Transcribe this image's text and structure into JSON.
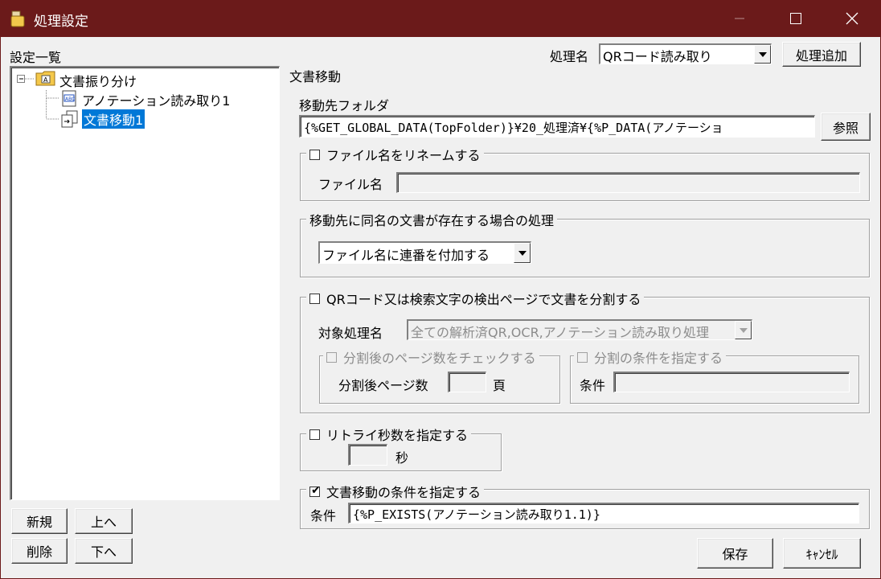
{
  "window": {
    "title": "処理設定"
  },
  "tree": {
    "heading": "設定一覧",
    "root": "文書振り分け",
    "children": [
      "アノテーション読み取り1",
      "文書移動1"
    ],
    "selected_index": 1
  },
  "left_buttons": {
    "new": "新規",
    "up": "上へ",
    "delete": "削除",
    "down": "下へ"
  },
  "header": {
    "process_name_label": "処理名",
    "process_name_value": "QRコード読み取り",
    "add_button": "処理追加"
  },
  "section_title": "文書移動",
  "dest_folder": {
    "label": "移動先フォルダ",
    "value": "{%GET_GLOBAL_DATA(TopFolder)}¥20_処理済¥{%P_DATA(アノテーショ",
    "browse_button": "参照"
  },
  "rename": {
    "checkbox_label": "ファイル名をリネームする",
    "checked": false,
    "field_label": "ファイル名",
    "field_value": ""
  },
  "duplicate": {
    "legend": "移動先に同名の文書が存在する場合の処理",
    "select_value": "ファイル名に連番を付加する"
  },
  "split": {
    "checkbox_label": "QRコード又は検索文字の検出ページで文書を分割する",
    "checked": false,
    "target_label": "対象処理名",
    "target_value": "全ての解析済QR,OCR,アノテーション読み取り処理",
    "page_check_label": "分割後のページ数をチェックする",
    "page_count_label": "分割後ページ数",
    "page_count_value": "",
    "page_unit": "頁",
    "cond_check_label": "分割の条件を指定する",
    "cond_label": "条件",
    "cond_value": ""
  },
  "retry": {
    "checkbox_label": "リトライ秒数を指定する",
    "checked": false,
    "value": "",
    "unit": "秒"
  },
  "move_condition": {
    "checkbox_label": "文書移動の条件を指定する",
    "checked": true,
    "check_mark": "✔",
    "cond_label": "条件",
    "cond_value": "{%P_EXISTS(アノテーション読み取り1.1)}"
  },
  "footer": {
    "save": "保存",
    "cancel": "ｷｬﾝｾﾙ"
  },
  "colors": {
    "titlebar": "#6b1a1a",
    "selection": "#0078d7",
    "window_bg": "#f0f0f0"
  }
}
